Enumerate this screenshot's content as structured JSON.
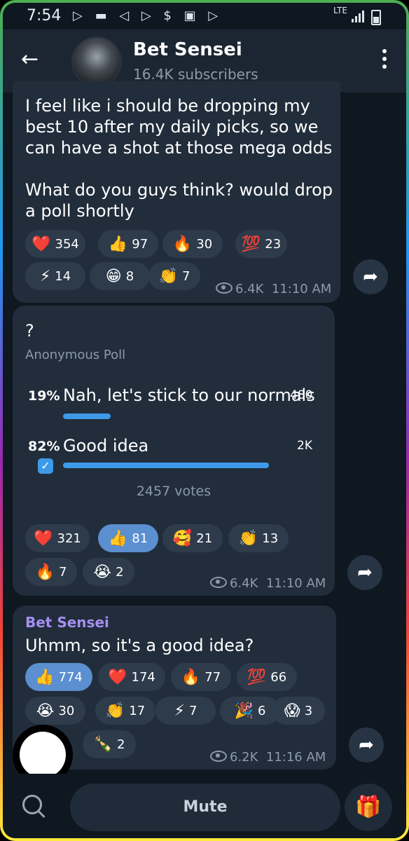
{
  "status_bar": {
    "time": "7:54",
    "network": "LTE"
  },
  "header": {
    "title": "Bet Sensei",
    "subtitle": "16.4K subscribers"
  },
  "message1": {
    "text": "I feel like i should be dropping my\nbest 10 after my daily picks, so we\ncan have a shot at those mega odds\n\nWhat do you guys think? would drop\na poll shortly",
    "reactions": [
      {
        "emoji": "❤️",
        "count": "354"
      },
      {
        "emoji": "👍",
        "count": "97"
      },
      {
        "emoji": "🔥",
        "count": "30"
      },
      {
        "emoji": "💯",
        "count": "23"
      },
      {
        "emoji": "⚡",
        "count": "14"
      },
      {
        "emoji": "😁",
        "count": "8"
      },
      {
        "emoji": "👏",
        "count": "7"
      }
    ],
    "views": "6.4K",
    "time": "11:10 AM"
  },
  "poll": {
    "question": "?",
    "kind": "Anonymous Poll",
    "options": [
      {
        "percent": "19%",
        "text": "Nah, let's stick to our normals",
        "votes": "480",
        "fill": 0.19,
        "chosen": false
      },
      {
        "percent": "82%",
        "text": "Good idea",
        "votes": "2K",
        "fill": 0.82,
        "chosen": true
      }
    ],
    "total": "2457 votes",
    "reactions": [
      {
        "emoji": "❤️",
        "count": "321"
      },
      {
        "emoji": "👍",
        "count": "81",
        "selected": true
      },
      {
        "emoji": "🥰",
        "count": "21"
      },
      {
        "emoji": "👏",
        "count": "13"
      },
      {
        "emoji": "🔥",
        "count": "7"
      },
      {
        "emoji": "😭",
        "count": "2"
      }
    ],
    "views": "6.4K",
    "time": "11:10 AM"
  },
  "message3": {
    "author": "Bet Sensei",
    "text": "Uhmm, so it's a good idea?",
    "reactions": [
      {
        "emoji": "👍",
        "count": "774",
        "selected": true
      },
      {
        "emoji": "❤️",
        "count": "174"
      },
      {
        "emoji": "🔥",
        "count": "77"
      },
      {
        "emoji": "💯",
        "count": "66"
      },
      {
        "emoji": "😭",
        "count": "30"
      },
      {
        "emoji": "👏",
        "count": "17"
      },
      {
        "emoji": "⚡",
        "count": "7"
      },
      {
        "emoji": "🎉",
        "count": "6"
      },
      {
        "emoji": "😱",
        "count": "3"
      },
      {
        "emoji": "🍾",
        "count": "2"
      }
    ],
    "views": "6.2K",
    "time": "11:16 AM"
  },
  "bottom": {
    "mute_label": "Mute"
  },
  "colors": {
    "accent": "#3e9ae8",
    "bubble": "#212d3b",
    "author": "#a68ff0"
  }
}
